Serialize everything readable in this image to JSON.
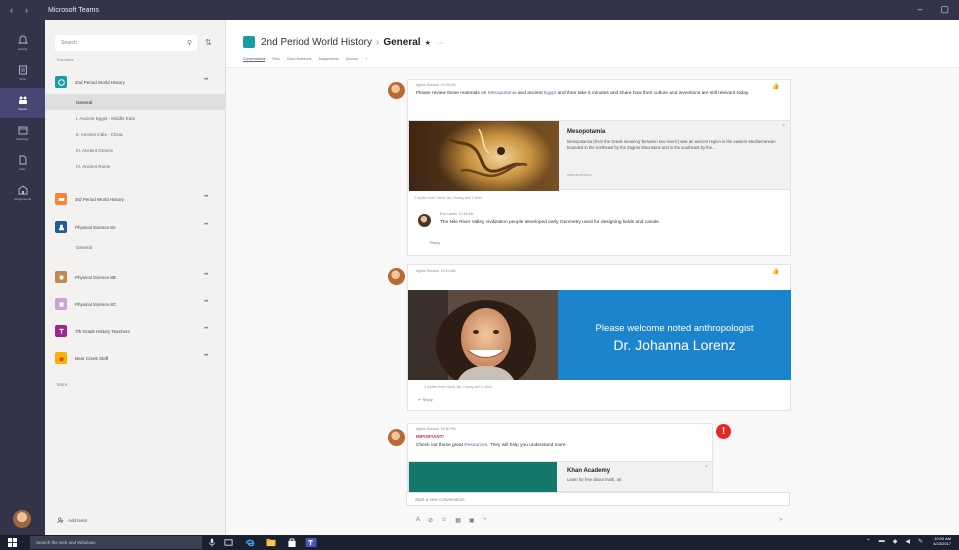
{
  "titlebar": {
    "app_title": "Microsoft Teams",
    "back": "‹",
    "forward": "›",
    "minimize": "–",
    "maximize": "▢"
  },
  "rail": [
    {
      "label": "Activity",
      "icon": "bell-icon"
    },
    {
      "label": "Chat",
      "icon": "chat-icon"
    },
    {
      "label": "Teams",
      "icon": "teams-icon",
      "active": true
    },
    {
      "label": "Meetings",
      "icon": "calendar-icon"
    },
    {
      "label": "Files",
      "icon": "file-icon"
    },
    {
      "label": "Assignments",
      "icon": "assignments-icon"
    }
  ],
  "teams_panel": {
    "search_placeholder": "Search",
    "section_label": "Favorites",
    "teams": [
      {
        "name": "2nd Period World History",
        "color": "#1b9ba3",
        "channels": [
          "General",
          "I. Ancient Egypt - Middle East",
          "II. Ancient India - China",
          "III. Ancient Greece",
          "IV. Ancient Rome"
        ]
      },
      {
        "name": "3rd Period World History",
        "color": "#f5853a",
        "channels": []
      },
      {
        "name": "Physical Science 8A",
        "color": "#1f5c98",
        "channels": [
          "General"
        ]
      },
      {
        "name": "Physical Science 8B",
        "color": "#c08a4e",
        "channels": []
      },
      {
        "name": "Physical Science 8C",
        "color": "#c8a2d8",
        "channels": []
      },
      {
        "name": "7th Grade History Teachers",
        "color": "#9a2a8a",
        "channels": []
      },
      {
        "name": "Bear Creek Staff",
        "color": "#f2b400",
        "channels": []
      }
    ],
    "more_label": "More",
    "add_team_label": "Add team"
  },
  "header": {
    "team_name": "2nd Period World History",
    "channel_name": "General",
    "tabs": [
      "Conversations",
      "Files",
      "Class Notebook",
      "Assignments",
      "Quizzes",
      "+"
    ]
  },
  "posts": {
    "p1": {
      "author": "Agnes Sorsian",
      "time": "10:03 AM",
      "text_before": "Please review these materials on ",
      "link1": "Mesopotamia",
      "text_mid": " and ancient ",
      "link2": "Egypt",
      "text_after": " and then take 5 minutes and share how their culture and inventions are still relevant today.",
      "card_title": "Mesopotamia",
      "card_body": "Mesopotamia (from the Greek meaning 'between two rivers') was an ancient region in the eastern Mediterranean bounded in the northeast by the Zagros Mountains and in the southeast by the...",
      "card_source": "www.ancient.eu",
      "replies_meta": "2 replies from Hardi, Ian, Hoang and 1 other",
      "reply": {
        "author": "Eva Lauen",
        "time": "10:44 AM",
        "text": "The Nile River Valley civilization people developed early Geometry used for designing fields and canals."
      },
      "reply_label": "Reply"
    },
    "p2": {
      "author": "Agnes Sorsian",
      "time": "10:12 AM",
      "banner_line1": "Please welcome noted anthropologist",
      "banner_line2": "Dr. Johanna Lorenz",
      "replies_meta": "3 replies from Hardi, Ian, Hoang and 1 other",
      "reply_label": "Reply"
    },
    "p3": {
      "author": "Agnes Sorsian",
      "time": "10:30 PM",
      "important": "IMPORTANT!",
      "text_before": "Check out these great ",
      "link": "Resources",
      "text_after": ". They will help you understand more.",
      "card_title": "Khan Academy",
      "card_body": "Learn for free about math, art"
    }
  },
  "compose": {
    "placeholder": "Start a new conversation"
  },
  "taskbar": {
    "search_placeholder": "Search the web and Windows",
    "time": "10:00 AM",
    "date": "4/23/2017"
  },
  "colors": {
    "rail_bg": "#33344a",
    "accent": "#6264a7",
    "banner_blue": "#1c84cc",
    "alert_red": "#e5262b"
  }
}
